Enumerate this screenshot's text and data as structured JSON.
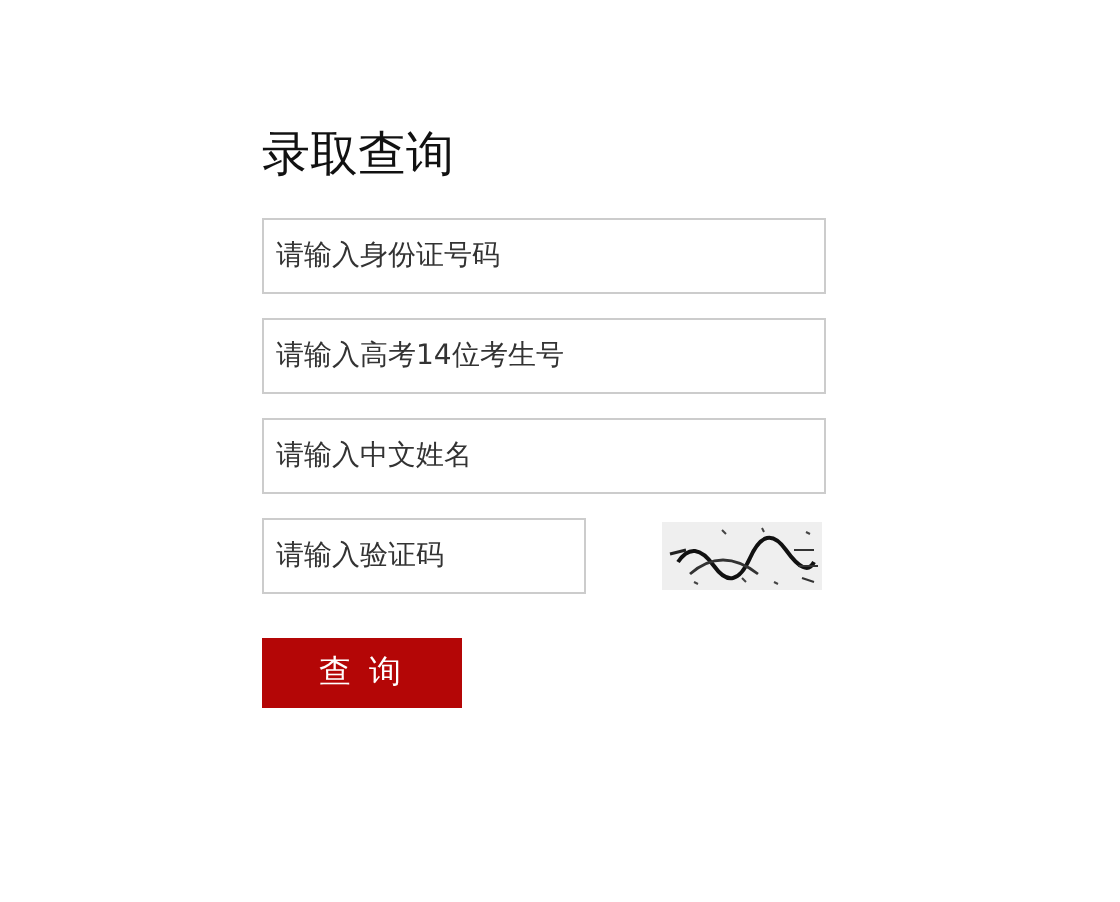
{
  "title": "录取查询",
  "fields": [
    {
      "placeholder": "请输入身份证号码"
    },
    {
      "placeholder": "请输入高考14位考生号"
    },
    {
      "placeholder": "请输入中文姓名"
    }
  ],
  "captcha": {
    "placeholder": "请输入验证码"
  },
  "submit_button": "查 询"
}
